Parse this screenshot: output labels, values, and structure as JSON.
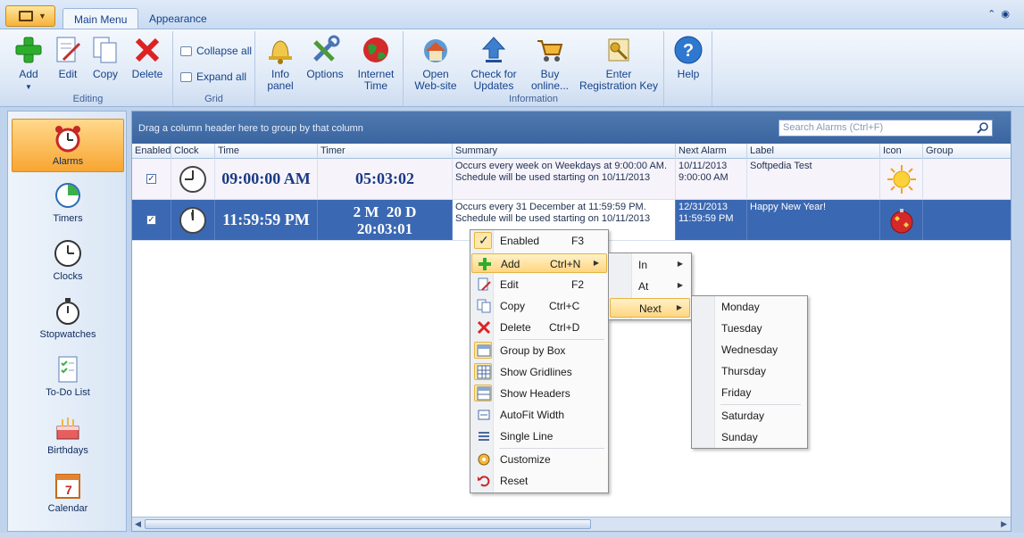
{
  "ribbon": {
    "tabs": [
      "Main Menu",
      "Appearance"
    ],
    "groups": {
      "editing": {
        "label": "Editing",
        "add": "Add",
        "edit": "Edit",
        "copy": "Copy",
        "delete": "Delete"
      },
      "grid": {
        "label": "Grid",
        "collapse": "Collapse all",
        "expand": "Expand all"
      },
      "info": {
        "info_panel_1": "Info",
        "info_panel_2": "panel",
        "options": "Options",
        "internet_1": "Internet",
        "internet_2": "Time"
      },
      "information": {
        "label": "Information",
        "open_1": "Open",
        "open_2": "Web-site",
        "check_1": "Check for",
        "check_2": "Updates",
        "buy_1": "Buy",
        "buy_2": "online...",
        "enter_1": "Enter",
        "enter_2": "Registration Key"
      },
      "help": {
        "label": "Help"
      }
    }
  },
  "nav": {
    "items": [
      "Alarms",
      "Timers",
      "Clocks",
      "Stopwatches",
      "To-Do List",
      "Birthdays",
      "Calendar"
    ]
  },
  "grid": {
    "group_hint": "Drag a column header here to group by that column",
    "search_placeholder": "Search Alarms (Ctrl+F)",
    "columns": [
      "Enabled",
      "Clock",
      "Time",
      "Timer",
      "Summary",
      "Next Alarm",
      "Label",
      "Icon",
      "Group"
    ],
    "rows": [
      {
        "enabled": true,
        "time": "09:00:00 AM",
        "timer": "05:03:02",
        "summary_1": "Occurs every week on Weekdays at 9:00:00 AM.",
        "summary_2": "Schedule will be used starting on 10/11/2013",
        "next_1": "10/11/2013",
        "next_2": "9:00:00 AM",
        "label": "Softpedia Test"
      },
      {
        "enabled": true,
        "time": "11:59:59 PM",
        "timer_1": "2 M  20 D",
        "timer_2": "20:03:01",
        "summary_1": "Occurs every 31 December at 11:59:59 PM.",
        "summary_2": "Schedule will be used starting on 10/11/2013",
        "next_1": "12/31/2013",
        "next_2": "11:59:59 PM",
        "label": "Happy New Year!"
      }
    ]
  },
  "context_menu": {
    "items": [
      {
        "label": "Enabled",
        "shortcut": "F3"
      },
      {
        "label": "Add",
        "shortcut": "Ctrl+N"
      },
      {
        "label": "Edit",
        "shortcut": "F2"
      },
      {
        "label": "Copy",
        "shortcut": "Ctrl+C"
      },
      {
        "label": "Delete",
        "shortcut": "Ctrl+D"
      },
      {
        "label": "Group by Box"
      },
      {
        "label": "Show Gridlines"
      },
      {
        "label": "Show Headers"
      },
      {
        "label": "AutoFit Width"
      },
      {
        "label": "Single Line"
      },
      {
        "label": "Customize"
      },
      {
        "label": "Reset"
      }
    ]
  },
  "add_submenu": {
    "items": [
      "In",
      "At",
      "Next"
    ]
  },
  "next_submenu": {
    "items": [
      "Monday",
      "Tuesday",
      "Wednesday",
      "Thursday",
      "Friday",
      "Saturday",
      "Sunday"
    ]
  },
  "colors": {
    "accent": "#3b68b2",
    "nav_active": "#f8a531",
    "ribbon": "#dde8f6"
  }
}
